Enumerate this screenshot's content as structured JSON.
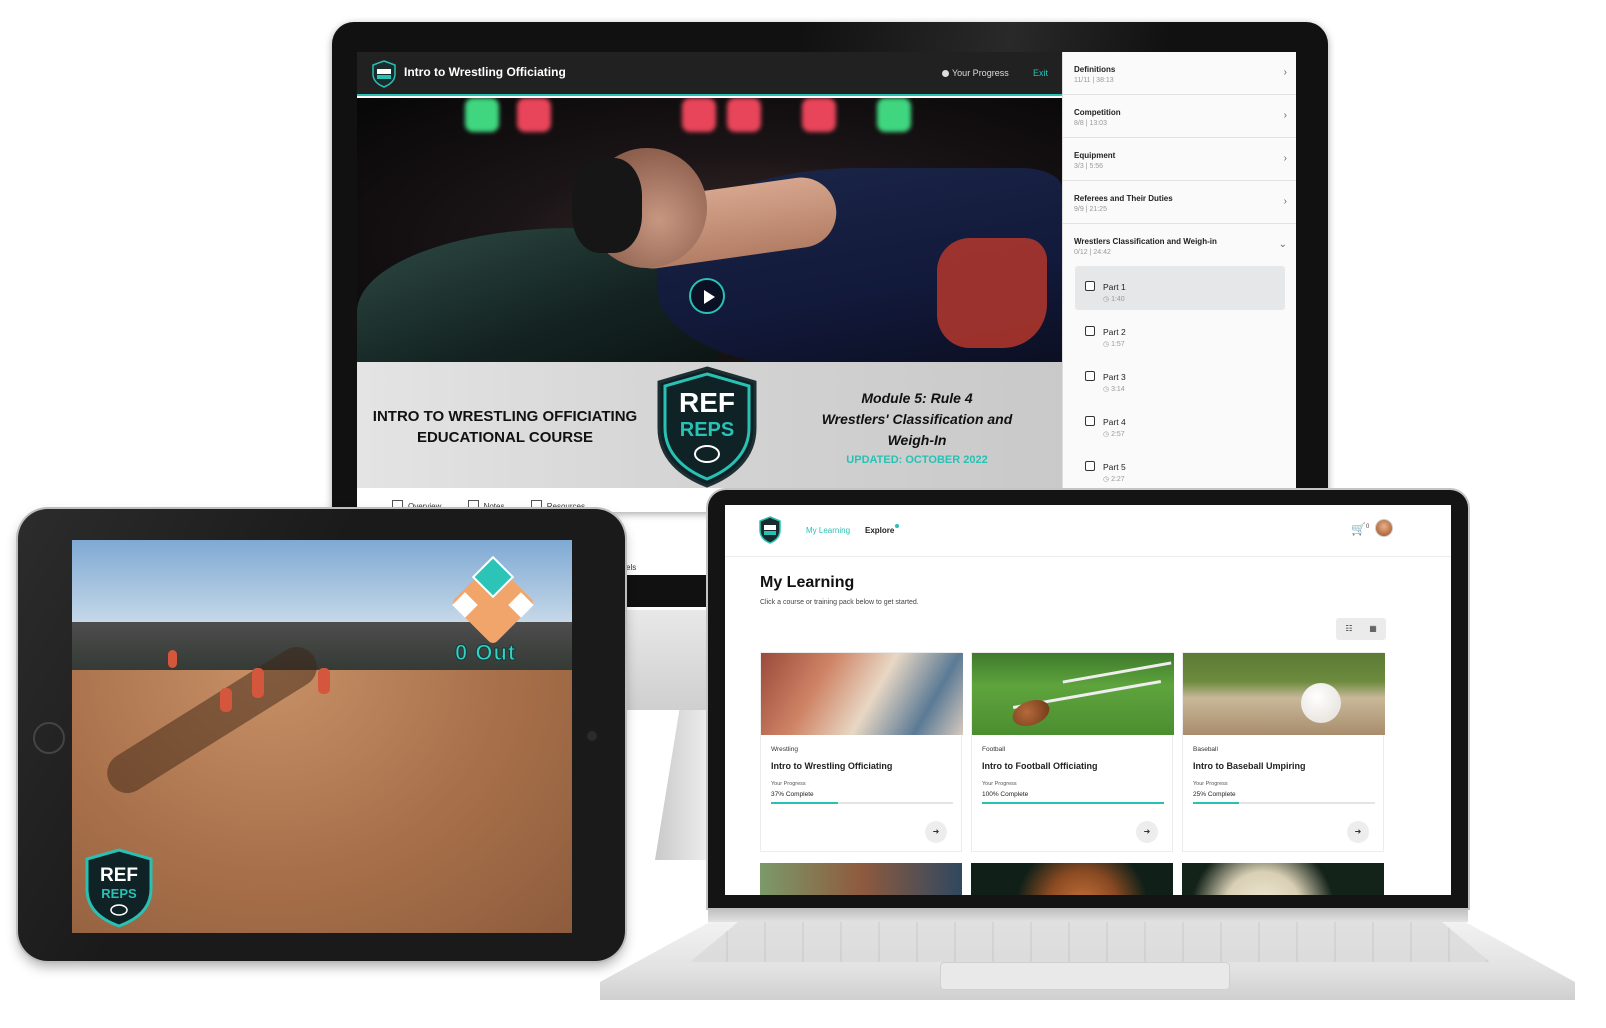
{
  "colors": {
    "accent": "#28c1b4",
    "dark": "#212121"
  },
  "course_player": {
    "title": "Intro to Wrestling Officiating",
    "progress_label": "Your Progress",
    "exit_label": "Exit",
    "banner": {
      "left_line1": "INTRO TO WRESTLING OFFICIATING",
      "left_line2": "EDUCATIONAL COURSE",
      "shield_line1": "REF",
      "shield_line2": "REPS",
      "module_line1": "Module 5: Rule 4",
      "module_line2": "Wrestlers' Classification and",
      "module_line3": "Weigh-In",
      "updated": "UPDATED: OCTOBER 2022"
    },
    "tabs": [
      "Overview",
      "Notes",
      "Resources"
    ],
    "partial_text": "vels",
    "modules": [
      {
        "name": "Definitions",
        "meta": "11/11 | 38:13"
      },
      {
        "name": "Competition",
        "meta": "8/8 | 13:03"
      },
      {
        "name": "Equipment",
        "meta": "3/3 | 5:56"
      },
      {
        "name": "Referees and Their Duties",
        "meta": "9/9 | 21:25"
      },
      {
        "name": "Wrestlers Classification and Weigh-in",
        "meta": "0/12 | 24:42"
      }
    ],
    "parts": [
      {
        "name": "Part 1",
        "duration": "1:40"
      },
      {
        "name": "Part 2",
        "duration": "1:57"
      },
      {
        "name": "Part 3",
        "duration": "3:14"
      },
      {
        "name": "Part 4",
        "duration": "2:57"
      },
      {
        "name": "Part 5",
        "duration": "2:27"
      }
    ]
  },
  "tablet": {
    "scoreboard_outs": "0 Out",
    "logo_line1": "REF",
    "logo_line2": "REPS"
  },
  "laptop": {
    "nav": {
      "my_learning": "My Learning",
      "explore": "Explore",
      "cart_count": "0"
    },
    "title": "My Learning",
    "subtitle": "Click a course or training pack below to get started.",
    "cards": [
      {
        "category": "Wrestling",
        "title": "Intro to Wrestling Officiating",
        "progress_label": "Your Progress",
        "progress_text": "37% Complete",
        "progress": 0.37
      },
      {
        "category": "Football",
        "title": "Intro to Football Officiating",
        "progress_label": "Your Progress",
        "progress_text": "100% Complete",
        "progress": 1.0
      },
      {
        "category": "Baseball",
        "title": "Intro to Baseball Umpiring",
        "progress_label": "Your Progress",
        "progress_text": "25% Complete",
        "progress": 0.25
      }
    ]
  }
}
